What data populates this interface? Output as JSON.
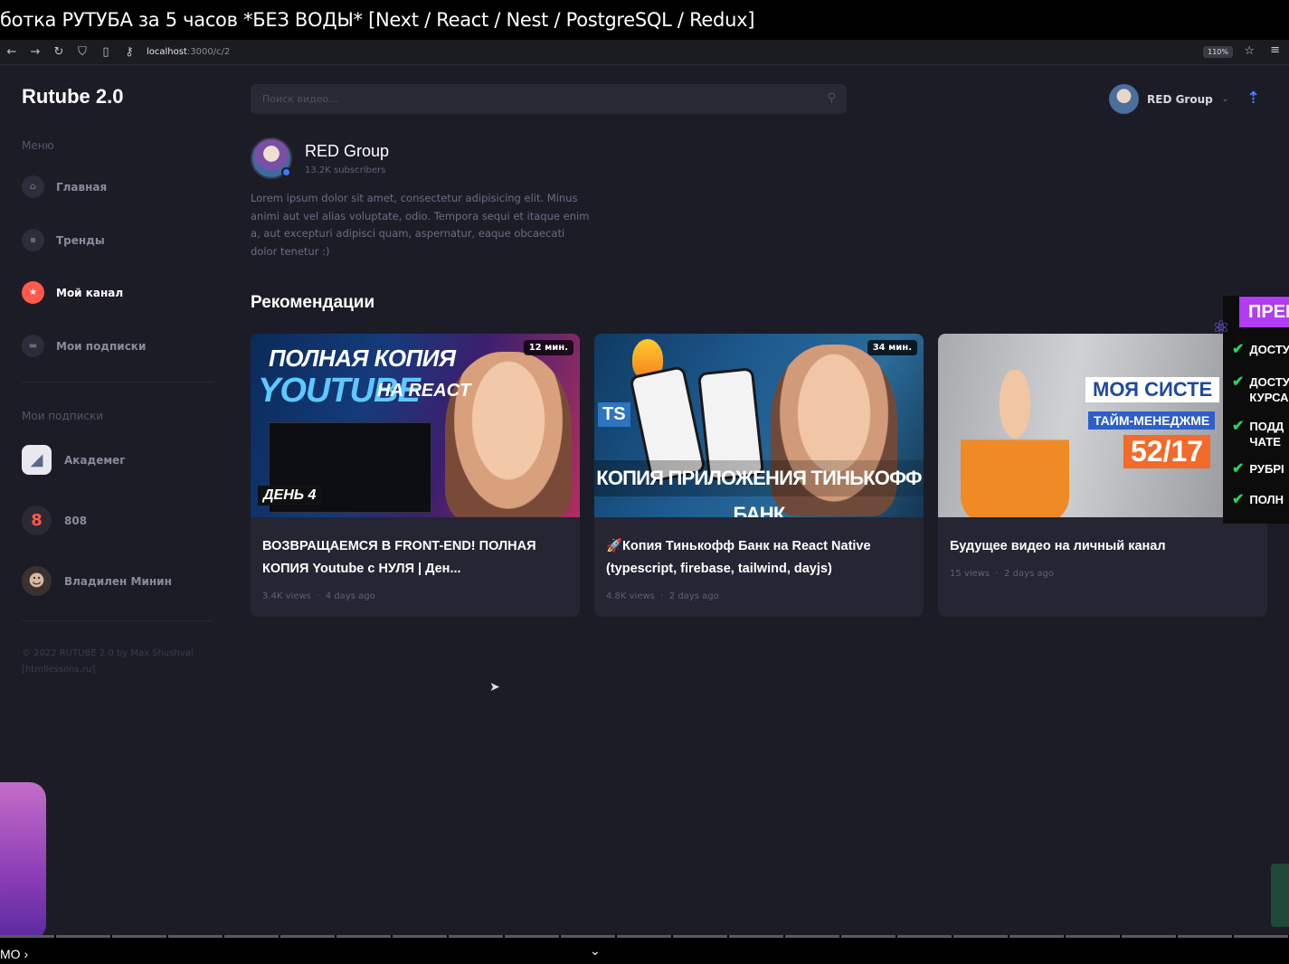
{
  "video_title": "ботка РУТУБА за 5 часов *БЕЗ ВОДЫ* [Next / React / Nest / PostgreSQL / Redux]",
  "browser": {
    "back_icon": "←",
    "forward_icon": "→",
    "reload_icon": "↻",
    "url_host": "localhost",
    "url_path": ":3000/c/2",
    "zoom": "110%"
  },
  "app": {
    "logo": "Rutube 2.0",
    "menu_label": "Меню",
    "menu": [
      {
        "label": "Главная",
        "icon": "home-icon",
        "glyph": "⌂"
      },
      {
        "label": "Тренды",
        "icon": "chart-icon",
        "glyph": "▪"
      },
      {
        "label": "Мой канал",
        "icon": "star-icon",
        "glyph": "★"
      },
      {
        "label": "Мои подписки",
        "icon": "subscriptions-icon",
        "glyph": "▬"
      }
    ],
    "subs_label": "Мои подписки",
    "subscriptions": [
      {
        "label": "Академег",
        "glyph": "◢"
      },
      {
        "label": "808",
        "glyph": "8"
      },
      {
        "label": "Владилен Минин",
        "glyph": "☻"
      }
    ],
    "footer_line1": "© 2022 RUTUBE 2.0 by Max Shushval",
    "footer_line2": "[htmllessons.ru]",
    "search_placeholder": "Поиск видео...",
    "user_name": "RED Group"
  },
  "channel": {
    "name": "RED Group",
    "subscribers": "13.2K subscribers",
    "description": "Lorem ipsum dolor sit amet, consectetur adipisicing elit. Minus animi aut vel alias voluptate, odio. Tempora sequi et itaque enim a, aut excepturi adipisci quam, aspernatur, eaque obcaecati dolor tenetur :)"
  },
  "recommendations_title": "Рекомендации",
  "videos": [
    {
      "title": "ВОЗВРАЩАЕМСЯ В FRONT-END! ПОЛНАЯ КОПИЯ Youtube с НУЛЯ | Ден...",
      "views": "3.4K views",
      "date": "4 days ago",
      "duration": "12 мин.",
      "thumb_text1": "ПОЛНАЯ КОПИЯ",
      "thumb_text2": "YOUTUBE",
      "thumb_text3": "НА REACT",
      "thumb_text4": "ДЕНЬ 4"
    },
    {
      "title": "🚀Копия Тинькофф Банк на React Native (typescript, firebase, tailwind, dayjs)",
      "views": "4.8K views",
      "date": "2 days ago",
      "duration": "34 мин.",
      "thumb_text1": "TS",
      "thumb_text2": "КОПИЯ ПРИЛОЖЕНИЯ ТИНЬКОФФ БАНК"
    },
    {
      "title": "Будущее видео на личный канал",
      "views": "15 views",
      "date": "2 days ago",
      "thumb_text1": "МОЯ СИСТЕ",
      "thumb_text2": "ТАЙМ-МЕНЕДЖМЕ",
      "thumb_text3": "52/17"
    }
  ],
  "promo": {
    "header": "ПРЕМ",
    "items": [
      "ДОСТУ",
      "ДОСТУ\nКУРСА",
      "ПОДД\nЧАТЕ",
      "РУБРІ",
      "ПОЛН"
    ]
  },
  "bottom": {
    "demo_label": "МО ›",
    "expand_icon": "⌄"
  },
  "colors": {
    "app_bg": "#1c1c27",
    "card_bg": "#252533",
    "accent": "#ff5a4a",
    "upload": "#4c7dff",
    "promo": "#b13cf2"
  }
}
